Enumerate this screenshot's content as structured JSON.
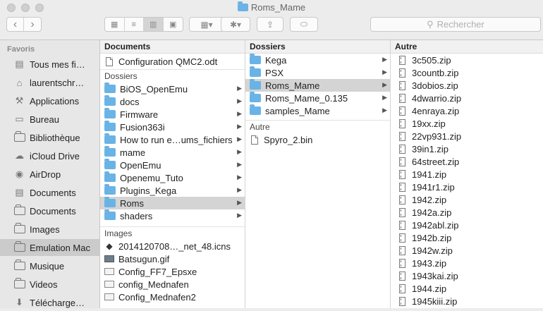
{
  "window": {
    "title": "Roms_Mame"
  },
  "toolbar": {
    "back": "‹",
    "forward": "›",
    "view_icon": "▦",
    "view_list": "≡",
    "view_columns": "▥",
    "view_coverflow": "▣",
    "arrange": "▦▾",
    "action": "✱▾",
    "share": "⇪",
    "tag": "⬭",
    "search_placeholder": "Rechercher"
  },
  "sidebar": {
    "header": "Favoris",
    "items": [
      {
        "label": "Tous mes fi…",
        "icon": "all-files-icon",
        "glyph": "▤"
      },
      {
        "label": "laurentschr…",
        "icon": "home-icon",
        "glyph": "⌂"
      },
      {
        "label": "Applications",
        "icon": "applications-icon",
        "glyph": "⚒"
      },
      {
        "label": "Bureau",
        "icon": "desktop-icon",
        "glyph": "▭"
      },
      {
        "label": "Bibliothèque",
        "icon": "folder-icon",
        "glyph": ""
      },
      {
        "label": "iCloud Drive",
        "icon": "cloud-icon",
        "glyph": "☁"
      },
      {
        "label": "AirDrop",
        "icon": "airdrop-icon",
        "glyph": "◉"
      },
      {
        "label": "Documents",
        "icon": "documents-icon",
        "glyph": "▤"
      },
      {
        "label": "Documents",
        "icon": "folder-icon",
        "glyph": ""
      },
      {
        "label": "Images",
        "icon": "folder-icon",
        "glyph": ""
      },
      {
        "label": "Emulation Mac",
        "icon": "folder-icon",
        "glyph": ""
      },
      {
        "label": "Musique",
        "icon": "folder-icon",
        "glyph": ""
      },
      {
        "label": "Videos",
        "icon": "folder-icon",
        "glyph": ""
      },
      {
        "label": "Télécharge…",
        "icon": "downloads-icon",
        "glyph": "⬇"
      }
    ],
    "selected_index": 10
  },
  "col1": {
    "header": "Documents",
    "top_file": "Configuration QMC2.odt",
    "folders_label": "Dossiers",
    "folders": [
      "BiOS_OpenEmu",
      "docs",
      "Firmware",
      "Fusion363i",
      "How to run e…ums_fichiers",
      "mame",
      "OpenEmu",
      "Openemu_Tuto",
      "Plugins_Kega",
      "Roms",
      "shaders"
    ],
    "selected_folder": "Roms",
    "images_label": "Images",
    "images": [
      {
        "name": "2014120708…_net_48.icns",
        "kind": "icns"
      },
      {
        "name": "Batsugun.gif",
        "kind": "gif"
      },
      {
        "name": "Config_FF7_Epsxe",
        "kind": "cfg"
      },
      {
        "name": "config_Mednafen",
        "kind": "cfg"
      },
      {
        "name": "Config_Mednafen2",
        "kind": "cfg"
      }
    ]
  },
  "col2": {
    "header": "Dossiers",
    "folders": [
      "Kega",
      "PSX",
      "Roms_Mame",
      "Roms_Mame_0.135",
      "samples_Mame"
    ],
    "selected_folder": "Roms_Mame",
    "other_label": "Autre",
    "files": [
      "Spyro_2.bin"
    ]
  },
  "col3": {
    "header": "Autre",
    "files": [
      "3c505.zip",
      "3countb.zip",
      "3dobios.zip",
      "4dwarrio.zip",
      "4enraya.zip",
      "19xx.zip",
      "22vp931.zip",
      "39in1.zip",
      "64street.zip",
      "1941.zip",
      "1941r1.zip",
      "1942.zip",
      "1942a.zip",
      "1942abl.zip",
      "1942b.zip",
      "1942w.zip",
      "1943.zip",
      "1943kai.zip",
      "1944.zip",
      "1945kiii.zip"
    ]
  },
  "arrow_glyph": "▶"
}
